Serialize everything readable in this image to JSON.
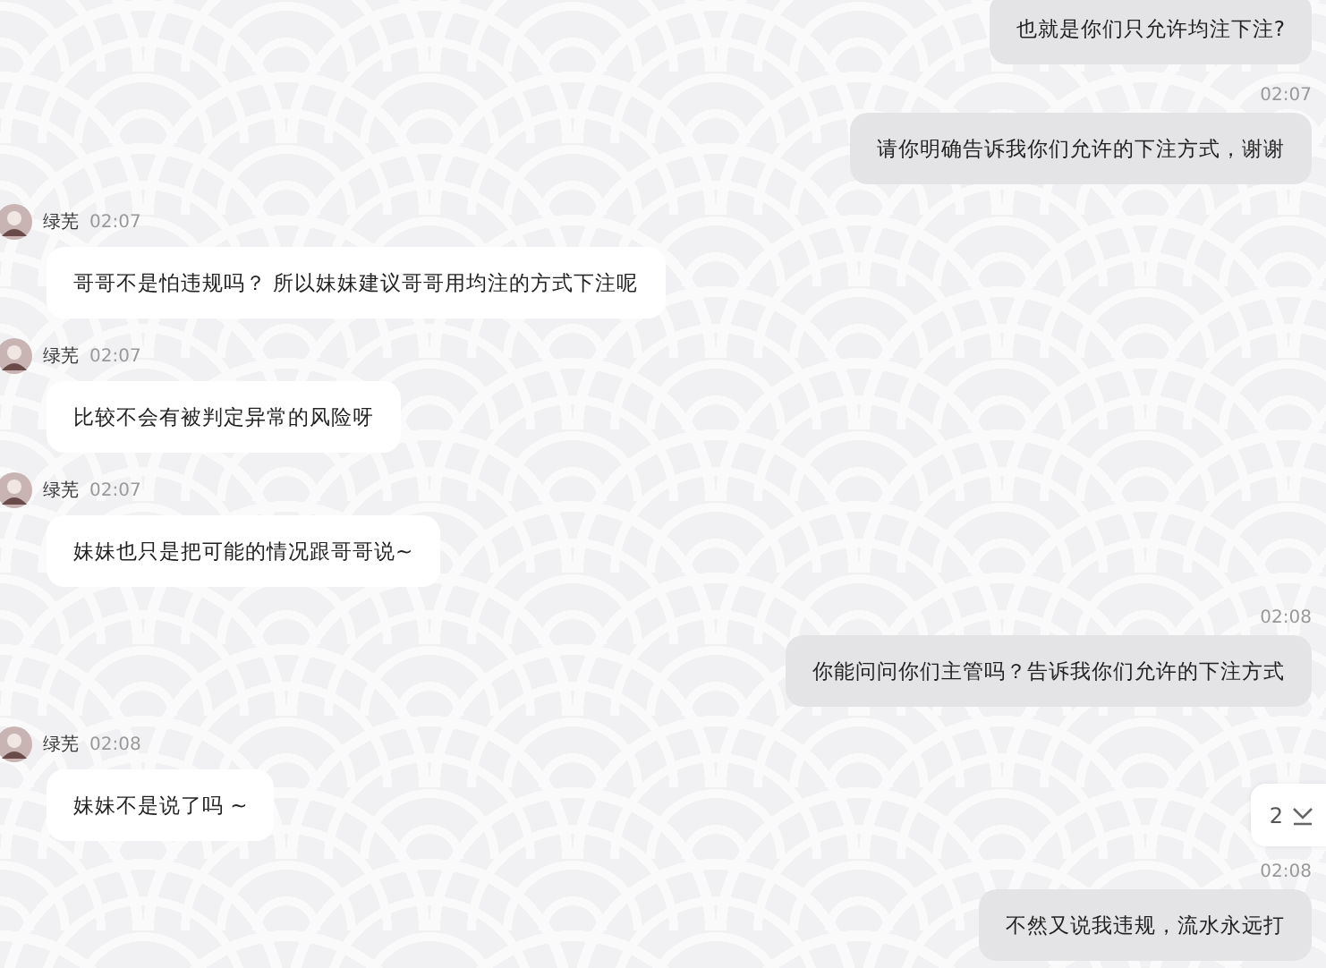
{
  "messages": [
    {
      "kind": "outgoing",
      "text": "也就是你们只允许均注下注?"
    },
    {
      "kind": "outgoing",
      "time": "02:07",
      "text": "请你明确告诉我你们允许的下注方式，谢谢"
    },
    {
      "kind": "incoming",
      "name": "绿芜",
      "time": "02:07",
      "text": "哥哥不是怕违规吗？ 所以妹妹建议哥哥用均注的方式下注呢"
    },
    {
      "kind": "incoming",
      "name": "绿芜",
      "time": "02:07",
      "text": "比较不会有被判定异常的风险呀"
    },
    {
      "kind": "incoming",
      "name": "绿芜",
      "time": "02:07",
      "text": "妹妹也只是把可能的情况跟哥哥说~"
    },
    {
      "kind": "outgoing",
      "time": "02:08",
      "text": "你能问问你们主管吗？告诉我你们允许的下注方式"
    },
    {
      "kind": "incoming",
      "name": "绿芜",
      "time": "02:08",
      "text": "妹妹不是说了吗 ~"
    },
    {
      "kind": "outgoing",
      "time": "02:08",
      "text": "不然又说我违规，流水永远打"
    }
  ],
  "new_messages": {
    "count": "2"
  }
}
